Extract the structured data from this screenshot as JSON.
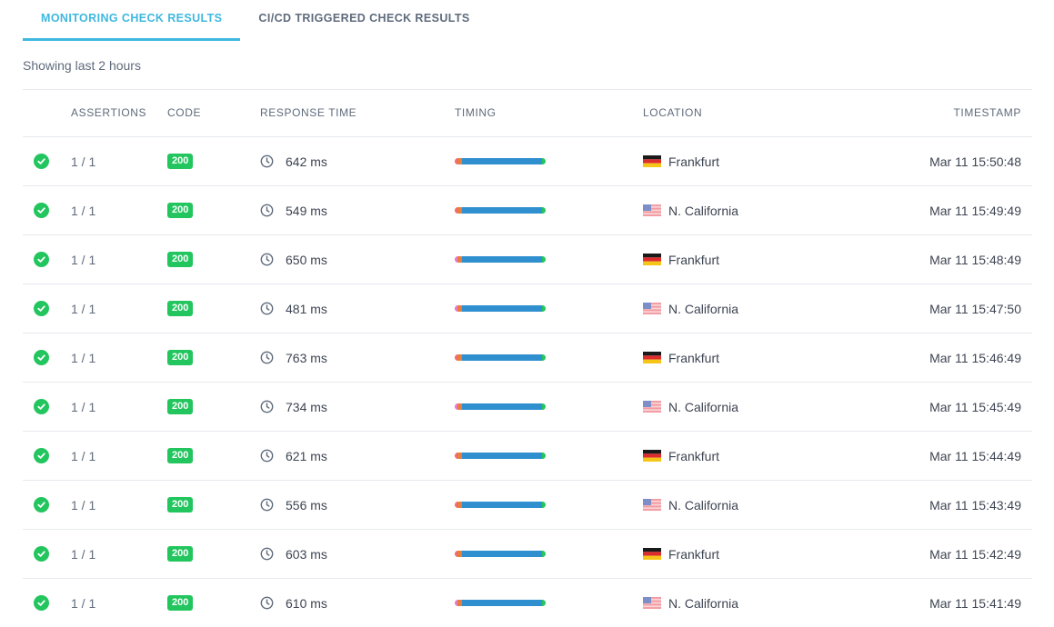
{
  "tabs": [
    {
      "label": "MONITORING CHECK RESULTS",
      "active": true
    },
    {
      "label": "CI/CD TRIGGERED CHECK RESULTS",
      "active": false
    }
  ],
  "subtitle": "Showing last 2 hours",
  "columns": {
    "assertions": "ASSERTIONS",
    "code": "CODE",
    "response_time": "RESPONSE TIME",
    "timing": "TIMING",
    "location": "LOCATION",
    "timestamp": "TIMESTAMP"
  },
  "colors": {
    "accent": "#3fb8e0",
    "success": "#22c55e",
    "timing_dns": "#f06b6b",
    "timing_connect": "#e87d3e",
    "timing_tls": "#e879c9",
    "timing_wait": "#2f8fcf",
    "timing_download": "#22c55e"
  },
  "rows": [
    {
      "assertions": "1 / 1",
      "code": "200",
      "response_time": "642 ms",
      "location": "Frankfurt",
      "flag": "flag-de-icon",
      "timestamp": "Mar 11 15:50:48"
    },
    {
      "assertions": "1 / 1",
      "code": "200",
      "response_time": "549 ms",
      "location": "N. California",
      "flag": "flag-us-icon",
      "timestamp": "Mar 11 15:49:49"
    },
    {
      "assertions": "1 / 1",
      "code": "200",
      "response_time": "650 ms",
      "location": "Frankfurt",
      "flag": "flag-de-icon",
      "timestamp": "Mar 11 15:48:49"
    },
    {
      "assertions": "1 / 1",
      "code": "200",
      "response_time": "481 ms",
      "location": "N. California",
      "flag": "flag-us-icon",
      "timestamp": "Mar 11 15:47:50"
    },
    {
      "assertions": "1 / 1",
      "code": "200",
      "response_time": "763 ms",
      "location": "Frankfurt",
      "flag": "flag-de-icon",
      "timestamp": "Mar 11 15:46:49"
    },
    {
      "assertions": "1 / 1",
      "code": "200",
      "response_time": "734 ms",
      "location": "N. California",
      "flag": "flag-us-icon",
      "timestamp": "Mar 11 15:45:49"
    },
    {
      "assertions": "1 / 1",
      "code": "200",
      "response_time": "621 ms",
      "location": "Frankfurt",
      "flag": "flag-de-icon",
      "timestamp": "Mar 11 15:44:49"
    },
    {
      "assertions": "1 / 1",
      "code": "200",
      "response_time": "556 ms",
      "location": "N. California",
      "flag": "flag-us-icon",
      "timestamp": "Mar 11 15:43:49"
    },
    {
      "assertions": "1 / 1",
      "code": "200",
      "response_time": "603 ms",
      "location": "Frankfurt",
      "flag": "flag-de-icon",
      "timestamp": "Mar 11 15:42:49"
    },
    {
      "assertions": "1 / 1",
      "code": "200",
      "response_time": "610 ms",
      "location": "N. California",
      "flag": "flag-us-icon",
      "timestamp": "Mar 11 15:41:49"
    }
  ]
}
